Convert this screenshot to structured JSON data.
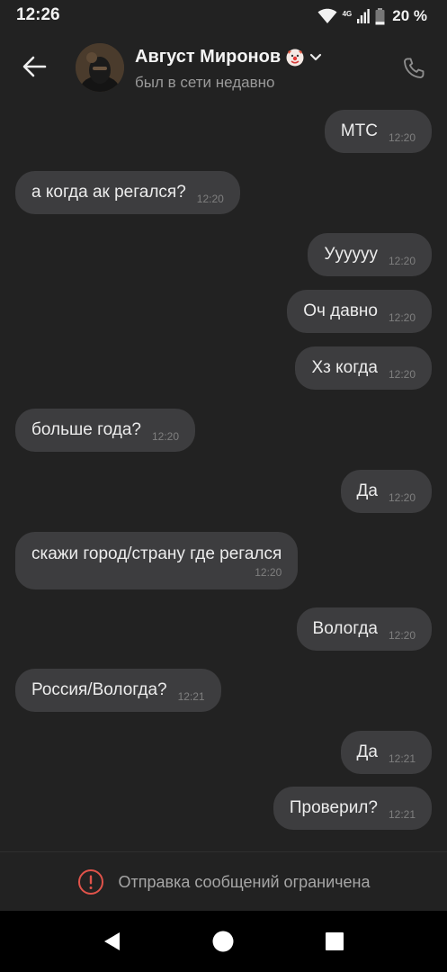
{
  "status_bar": {
    "time": "12:26",
    "network_label": "4G",
    "battery_percent": "20 %",
    "battery_level": 0.2
  },
  "header": {
    "contact_name": "Август Миронов",
    "name_emoji": "clown-face",
    "contact_status": "был в сети недавно",
    "icons": [
      "back-arrow-icon",
      "chevron-down-icon",
      "phone-icon"
    ]
  },
  "messages": [
    {
      "dir": "out",
      "text": "МТС",
      "time": "12:20"
    },
    {
      "dir": "in",
      "text": "а когда ак регался?",
      "time": "12:20"
    },
    {
      "dir": "out",
      "text": "Уууууу",
      "time": "12:20"
    },
    {
      "dir": "out",
      "text": "Оч давно",
      "time": "12:20"
    },
    {
      "dir": "out",
      "text": "Хз когда",
      "time": "12:20"
    },
    {
      "dir": "in",
      "text": "больше года?",
      "time": "12:20"
    },
    {
      "dir": "out",
      "text": "Да",
      "time": "12:20"
    },
    {
      "dir": "in",
      "text": "скажи город/страну где регался",
      "time": "12:20"
    },
    {
      "dir": "out",
      "text": "Вологда",
      "time": "12:20"
    },
    {
      "dir": "in",
      "text": "Россия/Вологда?",
      "time": "12:21"
    },
    {
      "dir": "out",
      "text": "Да",
      "time": "12:21"
    },
    {
      "dir": "out",
      "text": "Проверил?",
      "time": "12:21"
    }
  ],
  "restriction": {
    "text": "Отправка сообщений ограничена",
    "icon": "alert-circle-icon",
    "color": "#e0534a"
  },
  "colors": {
    "background": "#222222",
    "bubble": "#3d3d3f"
  }
}
